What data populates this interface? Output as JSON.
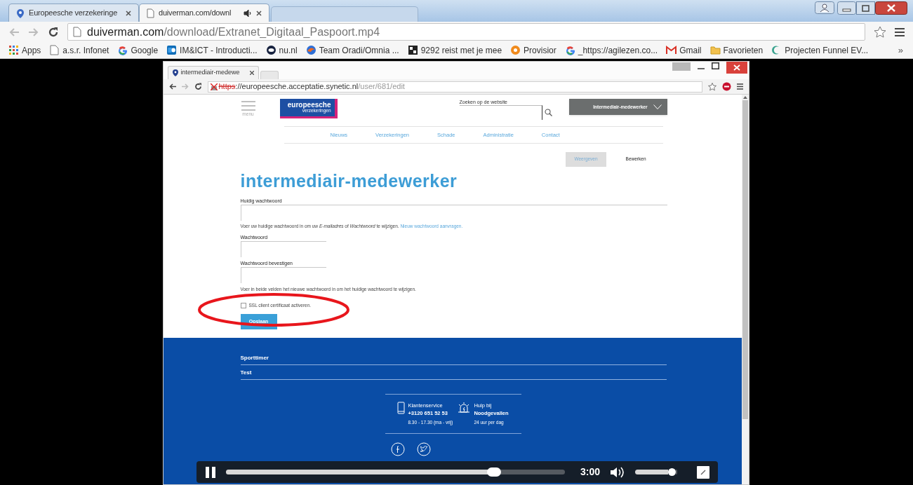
{
  "browser": {
    "tabs": [
      {
        "title": "Europeesche verzekeringe",
        "selected": false,
        "audio": false
      },
      {
        "title": "duiverman.com/downl",
        "selected": true,
        "audio": true
      }
    ],
    "url": {
      "host": "duiverman.com",
      "path": "/download/Extranet_Digitaal_Paspoort.mp4"
    },
    "bookmarks": [
      {
        "label": "Apps",
        "kind": "apps"
      },
      {
        "label": "a.s.r. Infonet",
        "kind": "page"
      },
      {
        "label": "Google",
        "kind": "google"
      },
      {
        "label": "IM&ICT - Introducti...",
        "kind": "sharepoint"
      },
      {
        "label": "nu.nl",
        "kind": "nu"
      },
      {
        "label": "Team Oradi/Omnia ...",
        "kind": "swirl"
      },
      {
        "label": "9292 reist met je mee",
        "kind": "ov"
      },
      {
        "label": "Provisior",
        "kind": "orange"
      },
      {
        "label": "_https://agilezen.co...",
        "kind": "google"
      },
      {
        "label": "Gmail",
        "kind": "gmail"
      },
      {
        "label": "Favorieten",
        "kind": "folder"
      },
      {
        "label": "Projecten Funnel EV...",
        "kind": "crescent"
      }
    ],
    "overflow": "»"
  },
  "recording": {
    "tab": {
      "title": "intermediair-medewe"
    },
    "url": {
      "scheme": "https",
      "host": "://europeesche.acceptatie.synetic.nl",
      "path": "/user/681/edit",
      "insecure": true
    },
    "header": {
      "menu_label": "menu",
      "logo": "europeesche",
      "logo_sub": "verzekeringen",
      "search_label": "Zoeken op de website",
      "user_button": "Intermediair-medewerker"
    },
    "nav": [
      "Nieuws",
      "Verzekeringen",
      "Schade",
      "Administratie",
      "Contact"
    ],
    "local_tabs": [
      {
        "label": "Weergeven",
        "selected": false
      },
      {
        "label": "Bewerken",
        "selected": true
      }
    ],
    "title": "intermediair-medewerker",
    "fields": [
      {
        "label": "Huidig wachtwoord",
        "kind": "wide",
        "description": "Voer uw huidige wachtwoord in om uw *E-mailadres* of *Wachtwoord* te wijzigen.",
        "link": "Nieuw wachtwoord aanvragen."
      },
      {
        "label": "Wachtwoord",
        "kind": "narrow"
      },
      {
        "label": "Wachtwoord bevestigen",
        "kind": "narrow",
        "description": "Voer in beide velden het nieuwe wachtwoord in om het huidige wachtwoord te wijzigen."
      }
    ],
    "checkbox": {
      "label": "SSL client certificaat activeren.",
      "checked": false
    },
    "save_button": "Opslaan",
    "footer_links": [
      "Sporttimer",
      "Test"
    ],
    "contacts": [
      {
        "kind": "phone",
        "title": "Klantenservice",
        "main": "+3120 651 52 53",
        "note": "8.30 - 17.30 (ma - vrij)"
      },
      {
        "kind": "alarm",
        "title": "Hulp bij",
        "main": "Noodgevallen",
        "note": "24 uur per dag"
      }
    ]
  },
  "player": {
    "playing": true,
    "level": 0.79,
    "time": "3:00",
    "volume": {
      "level": 0.95
    }
  }
}
